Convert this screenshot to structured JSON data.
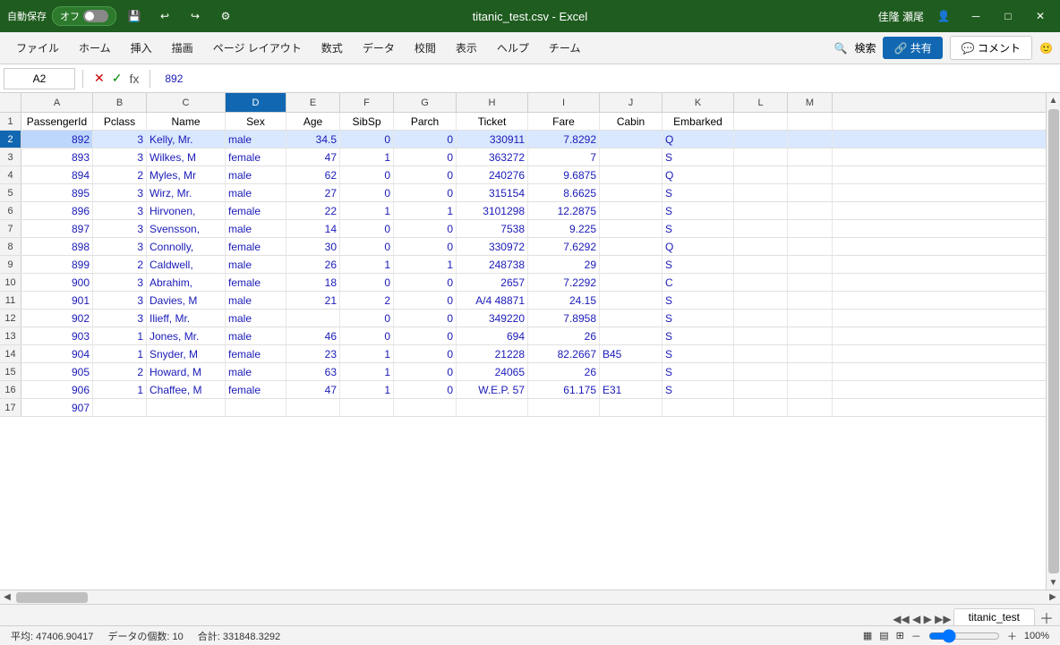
{
  "titlebar": {
    "autosave_label": "自動保存",
    "autosave_state": "オフ",
    "title": "titanic_test.csv  -  Excel",
    "user": "佳隆 瀬尾",
    "min_label": "─",
    "restore_label": "□",
    "close_label": "✕"
  },
  "menubar": {
    "items": [
      "ファイル",
      "ホーム",
      "挿入",
      "描画",
      "ページ レイアウト",
      "数式",
      "データ",
      "校閲",
      "表示",
      "ヘルプ",
      "チーム"
    ],
    "search_placeholder": "検索",
    "share_label": "共有",
    "comment_label": "コメント"
  },
  "formulabar": {
    "cell_ref": "A2",
    "formula_value": "892"
  },
  "columns": {
    "letters": [
      "A",
      "B",
      "C",
      "D",
      "E",
      "F",
      "G",
      "H",
      "I",
      "J",
      "K",
      "L",
      "M"
    ],
    "headers": [
      "PassengerId",
      "Pclass",
      "Name",
      "Sex",
      "Age",
      "SibSp",
      "Parch",
      "Ticket",
      "Fare",
      "Cabin",
      "Embarked",
      "",
      ""
    ]
  },
  "rows": [
    {
      "num": 1,
      "cells": [
        "PassengerId",
        "Pclass",
        "Name",
        "Sex",
        "Age",
        "SibSp",
        "Parch",
        "Ticket",
        "Fare",
        "Cabin",
        "Embarked",
        "",
        ""
      ]
    },
    {
      "num": 2,
      "cells": [
        "892",
        "3",
        "Kelly, Mr. ",
        "male",
        "34.5",
        "0",
        "0",
        "330911",
        "7.8292",
        "",
        "Q",
        "",
        ""
      ]
    },
    {
      "num": 3,
      "cells": [
        "893",
        "3",
        "Wilkes, M",
        "female",
        "47",
        "1",
        "0",
        "363272",
        "7",
        "",
        "S",
        "",
        ""
      ]
    },
    {
      "num": 4,
      "cells": [
        "894",
        "2",
        "Myles, Mr",
        "male",
        "62",
        "0",
        "0",
        "240276",
        "9.6875",
        "",
        "Q",
        "",
        ""
      ]
    },
    {
      "num": 5,
      "cells": [
        "895",
        "3",
        "Wirz, Mr. ",
        "male",
        "27",
        "0",
        "0",
        "315154",
        "8.6625",
        "",
        "S",
        "",
        ""
      ]
    },
    {
      "num": 6,
      "cells": [
        "896",
        "3",
        "Hirvonen,",
        "female",
        "22",
        "1",
        "1",
        "3101298",
        "12.2875",
        "",
        "S",
        "",
        ""
      ]
    },
    {
      "num": 7,
      "cells": [
        "897",
        "3",
        "Svensson,",
        "male",
        "14",
        "0",
        "0",
        "7538",
        "9.225",
        "",
        "S",
        "",
        ""
      ]
    },
    {
      "num": 8,
      "cells": [
        "898",
        "3",
        "Connolly, ",
        "female",
        "30",
        "0",
        "0",
        "330972",
        "7.6292",
        "",
        "Q",
        "",
        ""
      ]
    },
    {
      "num": 9,
      "cells": [
        "899",
        "2",
        "Caldwell, ",
        "male",
        "26",
        "1",
        "1",
        "248738",
        "29",
        "",
        "S",
        "",
        ""
      ]
    },
    {
      "num": 10,
      "cells": [
        "900",
        "3",
        "Abrahim, ",
        "female",
        "18",
        "0",
        "0",
        "2657",
        "7.2292",
        "",
        "C",
        "",
        ""
      ]
    },
    {
      "num": 11,
      "cells": [
        "901",
        "3",
        "Davies, M",
        "male",
        "21",
        "2",
        "0",
        "A/4 48871",
        "24.15",
        "",
        "S",
        "",
        ""
      ]
    },
    {
      "num": 12,
      "cells": [
        "902",
        "3",
        "Ilieff, Mr. ",
        "male",
        "",
        "0",
        "0",
        "349220",
        "7.8958",
        "",
        "S",
        "",
        ""
      ]
    },
    {
      "num": 13,
      "cells": [
        "903",
        "1",
        "Jones, Mr.",
        "male",
        "46",
        "0",
        "0",
        "694",
        "26",
        "",
        "S",
        "",
        ""
      ]
    },
    {
      "num": 14,
      "cells": [
        "904",
        "1",
        "Snyder, M",
        "female",
        "23",
        "1",
        "0",
        "21228",
        "82.2667",
        "B45",
        "S",
        "",
        ""
      ]
    },
    {
      "num": 15,
      "cells": [
        "905",
        "2",
        "Howard, M",
        "male",
        "63",
        "1",
        "0",
        "24065",
        "26",
        "",
        "S",
        "",
        ""
      ]
    },
    {
      "num": 16,
      "cells": [
        "906",
        "1",
        "Chaffee, M",
        "female",
        "47",
        "1",
        "0",
        "W.E.P. 57",
        "61.175",
        "E31",
        "S",
        "",
        ""
      ]
    },
    {
      "num": 17,
      "cells": [
        "907",
        "",
        "",
        "",
        "",
        "",
        "",
        "",
        "",
        "",
        "",
        "",
        ""
      ]
    }
  ],
  "tab": {
    "name": "titanic_test"
  },
  "statusbar": {
    "average": "平均: 47406.90417",
    "count": "データの個数: 10",
    "sum": "合計: 331848.3292",
    "zoom": "100%"
  },
  "cell_types": {
    "num_cols": [
      0,
      1,
      4,
      5,
      6,
      7,
      8
    ],
    "txt_cols": [
      2,
      3,
      9,
      10
    ]
  }
}
